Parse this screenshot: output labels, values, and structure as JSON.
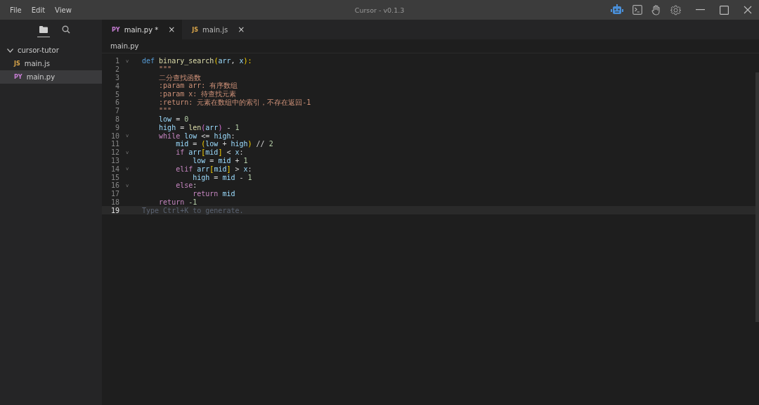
{
  "menu": [
    "File",
    "Edit",
    "View"
  ],
  "window": {
    "title": "Cursor - v0.1.3"
  },
  "sidebar": {
    "tabs": [
      {
        "kind": "files",
        "selected": true
      },
      {
        "kind": "search",
        "selected": false
      }
    ],
    "tree": [
      {
        "label": "cursor-tutor",
        "expanded": true,
        "children": [
          {
            "label": "main.js",
            "badge": "JS",
            "selected": false
          },
          {
            "label": "main.py",
            "badge": "PY",
            "selected": true
          }
        ]
      }
    ]
  },
  "tabs": [
    {
      "badge": "PY",
      "label": "main.py *",
      "close": "×",
      "selected": true
    },
    {
      "badge": "JS",
      "label": "main.js",
      "close": "×",
      "selected": false
    }
  ],
  "breadcrumb": "main.py",
  "lines": [
    {
      "number": "1",
      "fold": "v",
      "current": false,
      "tokens": [
        {
          "t": "def ",
          "kind": "def"
        },
        {
          "t": "binary_search",
          "kind": "func"
        },
        {
          "t": "(",
          "kind": "br"
        },
        {
          "t": "arr",
          "kind": "var"
        },
        {
          "t": ", ",
          "kind": "op"
        },
        {
          "t": "x",
          "kind": "var"
        },
        {
          "t": "):",
          "kind": "br"
        }
      ]
    },
    {
      "number": "2",
      "current": false,
      "tokens": [
        {
          "t": "    \"\"\"",
          "kind": "doc"
        }
      ]
    },
    {
      "number": "3",
      "current": false,
      "tokens": [
        {
          "t": "    二分查找函数",
          "kind": "doc"
        }
      ]
    },
    {
      "number": "4",
      "current": false,
      "tokens": [
        {
          "t": "    :param arr: 有序数组",
          "kind": "doc"
        }
      ]
    },
    {
      "number": "5",
      "current": false,
      "tokens": [
        {
          "t": "    :param x: 待查找元素",
          "kind": "doc"
        }
      ]
    },
    {
      "number": "6",
      "current": false,
      "tokens": [
        {
          "t": "    :return: 元素在数组中的索引，不存在返回-1",
          "kind": "doc"
        }
      ]
    },
    {
      "number": "7",
      "current": false,
      "tokens": [
        {
          "t": "    \"\"\"",
          "kind": "doc"
        }
      ]
    },
    {
      "number": "8",
      "current": false,
      "tokens": [
        {
          "t": "    low",
          "kind": "var"
        },
        {
          "t": " = ",
          "kind": "op"
        },
        {
          "t": "0",
          "kind": "num"
        }
      ]
    },
    {
      "number": "9",
      "current": false,
      "tokens": [
        {
          "t": "    high",
          "kind": "var"
        },
        {
          "t": " = ",
          "kind": "op"
        },
        {
          "t": "len",
          "kind": "func"
        },
        {
          "t": "(",
          "kind": "br2"
        },
        {
          "t": "arr",
          "kind": "var"
        },
        {
          "t": ")",
          "kind": "br2"
        },
        {
          "t": " - ",
          "kind": "op"
        },
        {
          "t": "1",
          "kind": "num"
        }
      ]
    },
    {
      "number": "10",
      "fold": "v",
      "current": false,
      "tokens": [
        {
          "t": "    while ",
          "kind": "ctrl"
        },
        {
          "t": "low",
          "kind": "var"
        },
        {
          "t": " <= ",
          "kind": "op"
        },
        {
          "t": "high",
          "kind": "var"
        },
        {
          "t": ":",
          "kind": "op"
        }
      ]
    },
    {
      "number": "11",
      "current": false,
      "tokens": [
        {
          "t": "        mid",
          "kind": "var"
        },
        {
          "t": " = ",
          "kind": "op"
        },
        {
          "t": "(",
          "kind": "br"
        },
        {
          "t": "low",
          "kind": "var"
        },
        {
          "t": " + ",
          "kind": "op"
        },
        {
          "t": "high",
          "kind": "var"
        },
        {
          "t": ")",
          "kind": "br"
        },
        {
          "t": " // ",
          "kind": "op"
        },
        {
          "t": "2",
          "kind": "num"
        }
      ]
    },
    {
      "number": "12",
      "fold": "v",
      "current": false,
      "tokens": [
        {
          "t": "        if ",
          "kind": "ctrl"
        },
        {
          "t": "arr",
          "kind": "var"
        },
        {
          "t": "[",
          "kind": "br"
        },
        {
          "t": "mid",
          "kind": "var"
        },
        {
          "t": "]",
          "kind": "br"
        },
        {
          "t": " < ",
          "kind": "op"
        },
        {
          "t": "x",
          "kind": "var"
        },
        {
          "t": ":",
          "kind": "op"
        }
      ]
    },
    {
      "number": "13",
      "current": false,
      "tokens": [
        {
          "t": "            low",
          "kind": "var"
        },
        {
          "t": " = ",
          "kind": "op"
        },
        {
          "t": "mid",
          "kind": "var"
        },
        {
          "t": " + ",
          "kind": "op"
        },
        {
          "t": "1",
          "kind": "num"
        }
      ]
    },
    {
      "number": "14",
      "fold": "v",
      "current": false,
      "tokens": [
        {
          "t": "        elif ",
          "kind": "ctrl"
        },
        {
          "t": "arr",
          "kind": "var"
        },
        {
          "t": "[",
          "kind": "br"
        },
        {
          "t": "mid",
          "kind": "var"
        },
        {
          "t": "]",
          "kind": "br"
        },
        {
          "t": " > ",
          "kind": "op"
        },
        {
          "t": "x",
          "kind": "var"
        },
        {
          "t": ":",
          "kind": "op"
        }
      ]
    },
    {
      "number": "15",
      "current": false,
      "tokens": [
        {
          "t": "            high",
          "kind": "var"
        },
        {
          "t": " = ",
          "kind": "op"
        },
        {
          "t": "mid",
          "kind": "var"
        },
        {
          "t": " - ",
          "kind": "op"
        },
        {
          "t": "1",
          "kind": "num"
        }
      ]
    },
    {
      "number": "16",
      "fold": "v",
      "current": false,
      "tokens": [
        {
          "t": "        else",
          "kind": "ctrl"
        },
        {
          "t": ":",
          "kind": "op"
        }
      ]
    },
    {
      "number": "17",
      "current": false,
      "tokens": [
        {
          "t": "            return ",
          "kind": "ctrl"
        },
        {
          "t": "mid",
          "kind": "var"
        }
      ]
    },
    {
      "number": "18",
      "current": false,
      "tokens": [
        {
          "t": "    return ",
          "kind": "ctrl"
        },
        {
          "t": "-1",
          "kind": "num"
        }
      ]
    },
    {
      "number": "19",
      "current": true,
      "tokens": [
        {
          "t": "Type Ctrl+K to generate.",
          "kind": "hint"
        }
      ]
    }
  ]
}
